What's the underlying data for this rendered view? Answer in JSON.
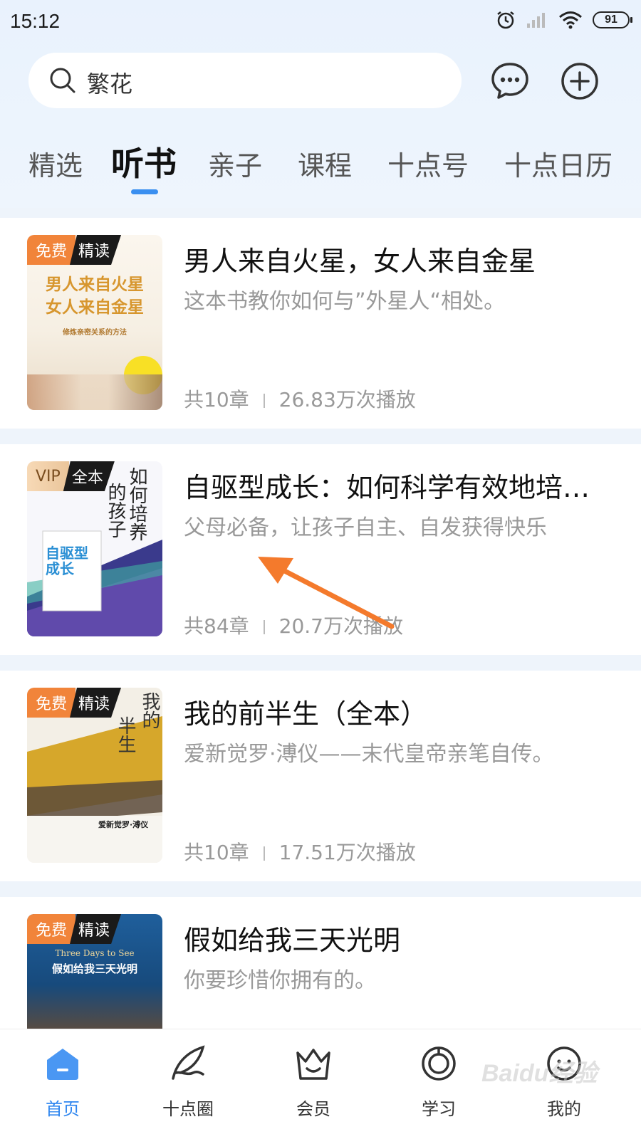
{
  "status_bar": {
    "time": "15:12",
    "battery": "91"
  },
  "search": {
    "text": "繁花"
  },
  "tabs": [
    {
      "label": "精选"
    },
    {
      "label": "听书"
    },
    {
      "label": "亲子"
    },
    {
      "label": "课程"
    },
    {
      "label": "十点号"
    },
    {
      "label": "十点日历"
    }
  ],
  "active_tab": "听书",
  "books": [
    {
      "badge_a": "免费",
      "badge_b": "精读",
      "cover_lines": [
        "男人来自火星",
        "女人来自金星",
        "修炼亲密关系的方法"
      ],
      "title": "男人来自火星，女人来自金星",
      "desc": "这本书教你如何与”外星人“相处。",
      "chapters": "共10章",
      "plays": "26.83万次播放"
    },
    {
      "badge_a": "VIP",
      "badge_b": "全本",
      "cover_lines": [
        "如何培养",
        "自驱型成长",
        "的孩子"
      ],
      "title": "自驱型成长：如何科学有效地培…",
      "desc": "父母必备，让孩子自主、自发获得快乐",
      "chapters": "共84章",
      "plays": "20.7万次播放"
    },
    {
      "badge_a": "免费",
      "badge_b": "精读",
      "cover_lines": [
        "我的",
        "半生",
        "爱新觉罗·溥仪"
      ],
      "title": "我的前半生（全本）",
      "desc": "爱新觉罗·溥仪——末代皇帝亲笔自传。",
      "chapters": "共10章",
      "plays": "17.51万次播放"
    },
    {
      "badge_a": "免费",
      "badge_b": "精读",
      "cover_lines": [
        "Three Days to See",
        "假如给我三天光明"
      ],
      "title": "假如给我三天光明",
      "desc": "你要珍惜你拥有的。"
    }
  ],
  "bottom_nav": [
    {
      "label": "首页",
      "icon": "home-icon"
    },
    {
      "label": "十点圈",
      "icon": "feather-icon"
    },
    {
      "label": "会员",
      "icon": "crown-icon"
    },
    {
      "label": "学习",
      "icon": "study-icon"
    },
    {
      "label": "我的",
      "icon": "profile-icon"
    }
  ],
  "watermark": "Baidu经验",
  "colors": {
    "accent": "#2f86ef",
    "badge_free": "#f1843a",
    "arrow": "#f47a2c"
  }
}
